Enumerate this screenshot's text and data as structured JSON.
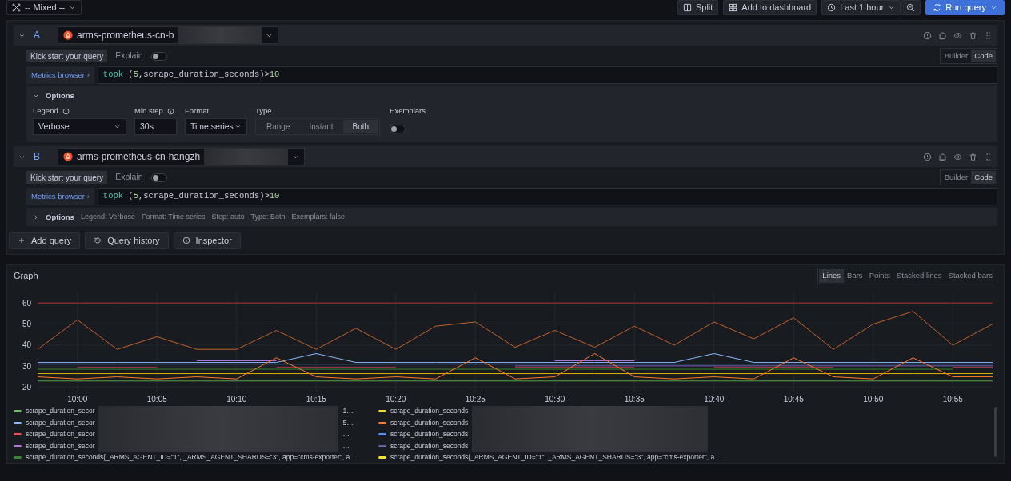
{
  "toolbar": {
    "datasource": "-- Mixed --",
    "buttons": [
      {
        "kind": "split",
        "label": "Split"
      },
      {
        "kind": "dashboard",
        "label": "Add to dashboard"
      },
      {
        "kind": "time",
        "label": "Last 1 hour"
      },
      {
        "kind": "zoom"
      },
      {
        "kind": "run",
        "label": "Run query"
      }
    ]
  },
  "queries": [
    {
      "letter": "A",
      "expanded": true,
      "datasource": "arms-prometheus-cn-b",
      "redacted": true,
      "kickstart": "Kick start your query",
      "explain_label": "Explain",
      "explain": false,
      "modes": [
        {
          "label": "Builder",
          "selected": false
        },
        {
          "label": "Code",
          "selected": true
        }
      ],
      "metrics_browser": "Metrics browser ›",
      "query_tokens": [
        {
          "kind": "function",
          "text": "topk"
        },
        {
          "kind": "plain",
          "text": " ("
        },
        {
          "kind": "number",
          "text": "5"
        },
        {
          "kind": "plain",
          "text": ",scrape_duration_seconds)>"
        },
        {
          "kind": "number",
          "text": "10"
        }
      ],
      "options": {
        "label": "Options",
        "expanded": true,
        "fields": [
          {
            "kind": "select",
            "label": "Legend",
            "info": true,
            "value": "Verbose"
          },
          {
            "kind": "input",
            "label": "Min step",
            "info": true,
            "value": "30s"
          },
          {
            "kind": "select",
            "label": "Format",
            "info": false,
            "value": "Time series"
          },
          {
            "kind": "segmented",
            "label": "Type",
            "items": [
              {
                "label": "Range",
                "selected": false
              },
              {
                "label": "Instant",
                "selected": false
              },
              {
                "label": "Both",
                "selected": true
              }
            ]
          },
          {
            "kind": "toggle",
            "label": "Exemplars",
            "on": false
          }
        ]
      }
    },
    {
      "letter": "B",
      "expanded": true,
      "datasource": "arms-prometheus-cn-hangzh",
      "redacted": true,
      "kickstart": "Kick start your query",
      "explain_label": "Explain",
      "explain": false,
      "modes": [
        {
          "label": "Builder",
          "selected": false
        },
        {
          "label": "Code",
          "selected": true
        }
      ],
      "metrics_browser": "Metrics browser ›",
      "query_tokens": [
        {
          "kind": "function",
          "text": "topk"
        },
        {
          "kind": "plain",
          "text": " ("
        },
        {
          "kind": "number",
          "text": "5"
        },
        {
          "kind": "plain",
          "text": ",scrape_duration_seconds)>"
        },
        {
          "kind": "number",
          "text": "10"
        }
      ],
      "options": {
        "label": "Options",
        "expanded": false,
        "summary": [
          "Legend: Verbose",
          "Format: Time series",
          "Step: auto",
          "Type: Both",
          "Exemplars: false"
        ]
      }
    }
  ],
  "actions": [
    {
      "kind": "add",
      "label": "Add query"
    },
    {
      "kind": "history",
      "label": "Query history"
    },
    {
      "kind": "info",
      "label": "Inspector"
    }
  ],
  "graph": {
    "title": "Graph",
    "views": [
      {
        "label": "Lines",
        "selected": true
      },
      {
        "label": "Bars",
        "selected": false
      },
      {
        "label": "Points",
        "selected": false
      },
      {
        "label": "Stacked lines",
        "selected": false
      },
      {
        "label": "Stacked bars",
        "selected": false
      }
    ],
    "chart_data": {
      "type": "line",
      "categories": [
        null,
        "10:00",
        null,
        "10:05",
        null,
        "10:10",
        null,
        "10:15",
        null,
        "10:20",
        null,
        "10:25",
        null,
        "10:30",
        null,
        "10:35",
        null,
        "10:40",
        null,
        "10:45",
        null,
        "10:50",
        null,
        "10:55",
        null
      ],
      "ylim": [
        18,
        65
      ],
      "yticks": [
        20,
        30,
        40,
        50,
        60
      ],
      "grid": true,
      "series": [
        {
          "color": "#b0302a",
          "values": [
            60,
            60,
            60,
            60,
            60,
            60,
            60,
            60,
            60,
            60,
            60,
            60,
            60,
            60,
            60,
            60,
            60,
            60,
            60,
            60,
            60,
            60,
            60,
            60,
            60
          ]
        },
        {
          "color": "#56a64b",
          "values": [
            23,
            23,
            23,
            23,
            23,
            23,
            23,
            23,
            23,
            23,
            23,
            23,
            23,
            23,
            23,
            23,
            23,
            23,
            23,
            23,
            23,
            23,
            23,
            23,
            23
          ]
        },
        {
          "color": "#e0b400",
          "values": [
            26.5,
            26.5,
            26.5,
            26.5,
            26.5,
            26.5,
            26.5,
            26.5,
            26.5,
            26.5,
            26.5,
            26.5,
            26.5,
            26.5,
            26.5,
            26.5,
            26.5,
            26.5,
            26.5,
            26.5,
            26.5,
            26.5,
            26.5,
            26.5,
            26.5
          ]
        },
        {
          "color": "#8ab8ff",
          "values": [
            31.8,
            31.8,
            31.8,
            31.8,
            31.8,
            31.8,
            31.8,
            36,
            31.8,
            31.8,
            31.8,
            31.8,
            31.8,
            31.8,
            31.8,
            31.8,
            31.8,
            36,
            31.8,
            31.8,
            31.8,
            31.8,
            31.8,
            31.8,
            31.8
          ]
        },
        {
          "color": "#c4612a",
          "values": [
            38,
            52,
            38,
            44,
            38,
            38,
            47,
            38,
            48,
            38,
            49,
            51,
            39,
            47,
            39,
            49,
            40,
            51,
            43,
            53,
            38,
            50,
            56,
            40,
            50
          ]
        },
        {
          "color": "#f2495c",
          "values": [
            null,
            29.4,
            29.4,
            29.4,
            null,
            null,
            29.4,
            29.4,
            29.4,
            29.4,
            null,
            null,
            29.4,
            29.4,
            29.4,
            29.4,
            null,
            29.4,
            29.4,
            29.4,
            29.4,
            null,
            null,
            29.4,
            29.4
          ]
        },
        {
          "color": "#5794f2",
          "values": [
            31,
            31,
            31,
            31,
            31,
            31,
            31,
            31,
            31,
            31,
            31,
            31,
            31,
            31,
            31,
            31,
            31,
            31,
            31,
            31,
            31,
            31,
            31,
            31,
            31
          ]
        },
        {
          "color": "#b877d9",
          "values": [
            null,
            null,
            null,
            null,
            32.6,
            32.6,
            32.6,
            null,
            null,
            null,
            null,
            null,
            null,
            32.6,
            32.6,
            32.6,
            null,
            null,
            null,
            null,
            null,
            null,
            null,
            null,
            null
          ]
        },
        {
          "color": "#6e5fb0",
          "values": [
            null,
            null,
            null,
            null,
            null,
            null,
            null,
            null,
            null,
            null,
            null,
            null,
            30.2,
            30.2,
            30.2,
            30.2,
            30.2,
            30.2,
            30.2,
            30.2,
            30.2,
            30.2,
            30.2,
            30.2,
            30.2
          ]
        },
        {
          "color": "#37872d",
          "values": [
            28.6,
            28.6,
            28.6,
            28.6,
            28.6,
            28.6,
            28.6,
            28.6,
            28.6,
            28.6,
            28.6,
            28.6,
            28.6,
            28.6,
            28.6,
            28.6,
            28.6,
            28.6,
            28.6,
            28.6,
            28.6,
            28.6,
            28.6,
            28.6,
            null
          ]
        },
        {
          "color": "#ff7a2b",
          "values": [
            25,
            24,
            25,
            24,
            25,
            24,
            34,
            25,
            24,
            25,
            24,
            34,
            24,
            25,
            36,
            25,
            24,
            25,
            24,
            34,
            25,
            24,
            34,
            25,
            25
          ]
        }
      ]
    },
    "legend": [
      {
        "color": "#73bf69",
        "label": "scrape_duration_secor",
        "redacted": true,
        "tail": "1…"
      },
      {
        "color": "#fade2a",
        "label": "scrape_duration_seconds",
        "redacted": true
      },
      {
        "color": "#8ab8ff",
        "label": "scrape_duration_secor",
        "redacted": true,
        "tail": "5…"
      },
      {
        "color": "#ff7a2b",
        "label": "scrape_duration_seconds",
        "redacted": true
      },
      {
        "color": "#f2495c",
        "label": "scrape_duration_secor",
        "redacted": true,
        "tail": "…"
      },
      {
        "color": "#5794f2",
        "label": "scrape_duration_seconds",
        "redacted": true
      },
      {
        "color": "#b877d9",
        "label": "scrape_duration_secor",
        "redacted": true,
        "tail": "…"
      },
      {
        "color": "#6e5fb0",
        "label": "scrape_duration_seconds",
        "redacted": true
      },
      {
        "color": "#37872d",
        "label": "scrape_duration_seconds{_ARMS_AGENT_ID=\"1\", _ARMS_AGENT_SHARDS=\"3\", app=\"cms-exporter\", a…",
        "redacted": false
      },
      {
        "color": "#fade2a",
        "label": "scrape_duration_seconds{_ARMS_AGENT_ID=\"1\", _ARMS_AGENT_SHARDS=\"3\", app=\"cms-exporter\", a…",
        "redacted": false
      }
    ]
  }
}
